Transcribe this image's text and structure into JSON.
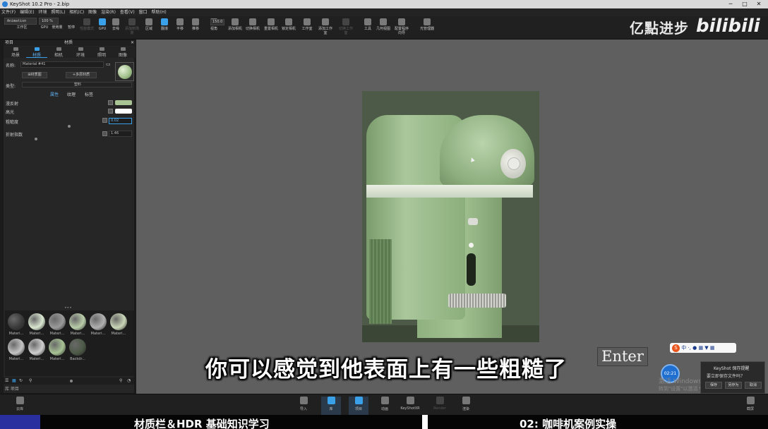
{
  "window": {
    "title": "KeyShot 10.2 Pro  - 2.bip",
    "controls": [
      "─",
      "□",
      "✕"
    ]
  },
  "menu": [
    "文件(F)",
    "编辑(E)",
    "环境",
    "照明(L)",
    "相机(C)",
    "图像",
    "渲染(R)",
    "查看(V)",
    "窗口",
    "帮助(H)"
  ],
  "ribbon": {
    "animation_value": "Animation",
    "zoom_value": "100 %",
    "numeric_value": "150.0",
    "buttons": [
      {
        "label": "工作区",
        "icon": "workspace-icon"
      },
      {
        "label": "GPU",
        "icon": "gpu-icon"
      },
      {
        "label": "使用量",
        "icon": "cpu-usage-icon"
      },
      {
        "label": "暂停",
        "icon": "pause-icon"
      },
      {
        "label": "性能模式",
        "icon": "performance-icon"
      },
      {
        "label": "GPU",
        "icon": "gpu-render-icon"
      },
      {
        "label": "去噪",
        "icon": "denoise-icon"
      },
      {
        "label": "添加到场景",
        "icon": "add-scene-icon"
      },
      {
        "label": "区域",
        "icon": "region-icon"
      },
      {
        "label": "翻滚",
        "icon": "tumble-icon"
      },
      {
        "label": "平移",
        "icon": "pan-icon"
      },
      {
        "label": "推移",
        "icon": "dolly-icon"
      },
      {
        "label": "视角",
        "icon": "fov-icon"
      },
      {
        "label": "添加相机",
        "icon": "add-camera-icon"
      },
      {
        "label": "切换相机",
        "icon": "switch-camera-icon"
      },
      {
        "label": "重置相机",
        "icon": "reset-camera-icon"
      },
      {
        "label": "锁定相机",
        "icon": "lock-camera-icon"
      },
      {
        "label": "工作室",
        "icon": "studio-icon"
      },
      {
        "label": "添加工作室",
        "icon": "add-studio-icon"
      },
      {
        "label": "切换工作室",
        "icon": "switch-studio-icon"
      },
      {
        "label": "工具",
        "icon": "tools-icon"
      },
      {
        "label": "几何视图",
        "icon": "geometry-view-icon"
      },
      {
        "label": "配置程序向导",
        "icon": "configurator-icon"
      },
      {
        "label": "光管理器",
        "icon": "light-manager-icon"
      }
    ]
  },
  "watermark": {
    "text": "亿點进步",
    "brand": "bilibili"
  },
  "panel": {
    "left_title": "项目",
    "center_title": "材质",
    "tabs": [
      "场景",
      "材质",
      "相机",
      "环境",
      "照明",
      "图像"
    ],
    "active_tab": "材质",
    "name_label": "名称:",
    "name_value": "Material #41",
    "btn_graph": "材质图",
    "btn_multi": "多层材质",
    "type_label": "类型:",
    "type_value": "塑料",
    "subtabs": [
      "属性",
      "纹理",
      "标签"
    ],
    "props": [
      {
        "label": "漫反射",
        "color": "#a9c596"
      },
      {
        "label": "高光",
        "color": "#ffffff"
      },
      {
        "label": "粗糙度",
        "value": "0.02"
      },
      {
        "label": "折射指数",
        "value": "1.46"
      }
    ],
    "library": [
      {
        "name": "Materi...",
        "color": "#3a3a3a"
      },
      {
        "name": "Materi...",
        "color": "#d9e6d0"
      },
      {
        "name": "Materi...",
        "color": "#9a9a9a"
      },
      {
        "name": "Materi...",
        "color": "#b9cda9"
      },
      {
        "name": "Materi...",
        "color": "#b0b0b0"
      },
      {
        "name": "Materi...",
        "color": "#c9d6b6"
      },
      {
        "name": "Materi...",
        "color": "#c4c4c4"
      },
      {
        "name": "Materi...",
        "color": "#cfcfcf"
      },
      {
        "name": "Materi...",
        "color": "#a7c394"
      },
      {
        "name": "Backdr...",
        "color": "#4d5a47"
      }
    ],
    "footer": "库 项目"
  },
  "subtitle": "你可以感觉到他表面上有一些粗糙了",
  "enter_key": "Enter",
  "ime": {
    "logo": "S",
    "text": "中 ·, ● ▦ ▼ ▦"
  },
  "clock": "02:21",
  "activate_text": [
    "激活 Windows",
    "转到\"设置\"以激活 Windows。"
  ],
  "save_dialog": {
    "title": "KeyShot 保存提醒",
    "message": "要立即保存文件吗？",
    "buttons": [
      "保存",
      "另存为",
      "取消"
    ]
  },
  "bottombar": [
    {
      "label": "云库",
      "icon": "cloud-library-icon"
    },
    {
      "label": "导入",
      "icon": "import-icon"
    },
    {
      "label": "库",
      "icon": "library-icon",
      "active": true
    },
    {
      "label": "项目",
      "icon": "project-icon",
      "active": true
    },
    {
      "label": "动画",
      "icon": "animation-icon"
    },
    {
      "label": "KeyShotXR",
      "icon": "keyshotxr-icon"
    },
    {
      "label": "Render",
      "icon": "render-dim-icon",
      "dim": true
    },
    {
      "label": "渲染",
      "icon": "render-icon"
    },
    {
      "label": "截屏",
      "icon": "screenshot-icon"
    }
  ],
  "caption": {
    "left": "材质栏＆HDR 基础知识学习",
    "right": "02: 咖啡机案例实操"
  },
  "colors": {
    "accent": "#3aa0e8",
    "viewport": "#5f5f5f",
    "machine_green": "#a9c596",
    "caption_blue": "#2a2fa0"
  }
}
